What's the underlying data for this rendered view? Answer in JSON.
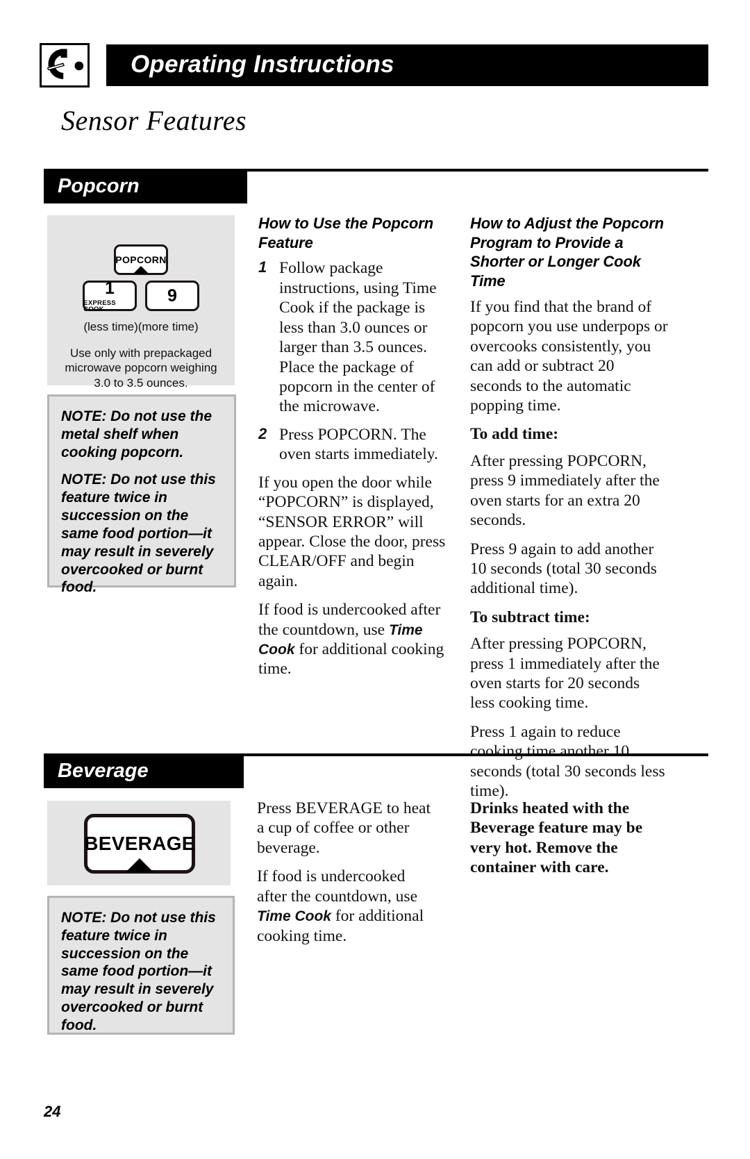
{
  "header": {
    "icon": "microwave-dial-icon",
    "title": "Operating Instructions"
  },
  "page_title": "Sensor Features",
  "page_number": "24",
  "sections": [
    {
      "id": "popcorn",
      "bar_label": "Popcorn",
      "key_panel": {
        "keys": [
          {
            "name": "popcorn-key",
            "label": "POPCORN",
            "sublabel": ""
          },
          {
            "name": "one-express-cook-key",
            "label": "1",
            "sublabel": "EXPRESS COOK"
          },
          {
            "name": "nine-key",
            "label": "9",
            "sublabel": ""
          }
        ],
        "caption_line": "(less time)(more time)",
        "caption_block": "Use only with prepackaged microwave popcorn weighing 3.0 to 3.5 ounces."
      },
      "notes": [
        "NOTE: Do not use the metal shelf when cooking popcorn.",
        "NOTE: Do not use this feature twice in succession on the same food portion—it may result in severely overcooked or burnt food."
      ],
      "middle_column": {
        "heading": "How to Use the Popcorn Feature",
        "steps": [
          {
            "num": "1",
            "text": "Follow package instructions, using Time Cook if the package is less than 3.0 ounces or larger than 3.5 ounces. Place the package of popcorn in the center of the microwave."
          },
          {
            "num": "2",
            "text": "Press POPCORN. The oven starts immediately."
          }
        ],
        "paragraphs": [
          "If you open the door while “POPCORN” is displayed, “SENSOR ERROR” will appear. Close the door, press CLEAR/OFF and begin again."
        ],
        "undercooked_prefix": "If food is undercooked after the countdown, use ",
        "undercooked_bold": "Time Cook",
        "undercooked_suffix": " for additional cooking time."
      },
      "right_column": {
        "heading": "How to Adjust the Popcorn Program to Provide a Shorter or Longer Cook Time",
        "intro": "If you find that the brand of popcorn you use underpops or overcooks consistently, you can add or subtract 20 seconds to the automatic popping time.",
        "add_subhead": "To add time:",
        "add_paragraphs": [
          "After pressing POPCORN, press 9 immediately after the oven starts for an extra 20 seconds.",
          "Press 9 again to add another 10 seconds (total 30 seconds additional time)."
        ],
        "subtract_subhead": "To subtract time:",
        "subtract_paragraphs": [
          "After pressing POPCORN, press 1 immediately after the oven starts for 20 seconds less cooking time.",
          "Press 1 again to reduce cooking time another 10 seconds (total 30 seconds less time)."
        ]
      }
    },
    {
      "id": "beverage",
      "bar_label": "Beverage",
      "key_panel": {
        "keys": [
          {
            "name": "beverage-key",
            "label": "BEVERAGE",
            "sublabel": ""
          }
        ]
      },
      "notes": [
        "NOTE: Do not use this feature twice in succession on the same food portion—it may result in severely overcooked or burnt food."
      ],
      "middle_column": {
        "paragraphs": [
          "Press BEVERAGE to heat a cup of coffee or other beverage."
        ],
        "undercooked_prefix": "If food is undercooked after the countdown, use ",
        "undercooked_bold": "Time Cook",
        "undercooked_suffix": " for additional cooking time."
      },
      "right_column": {
        "warning": "Drinks heated with the Beverage feature may be very hot. Remove the container with care."
      }
    }
  ]
}
